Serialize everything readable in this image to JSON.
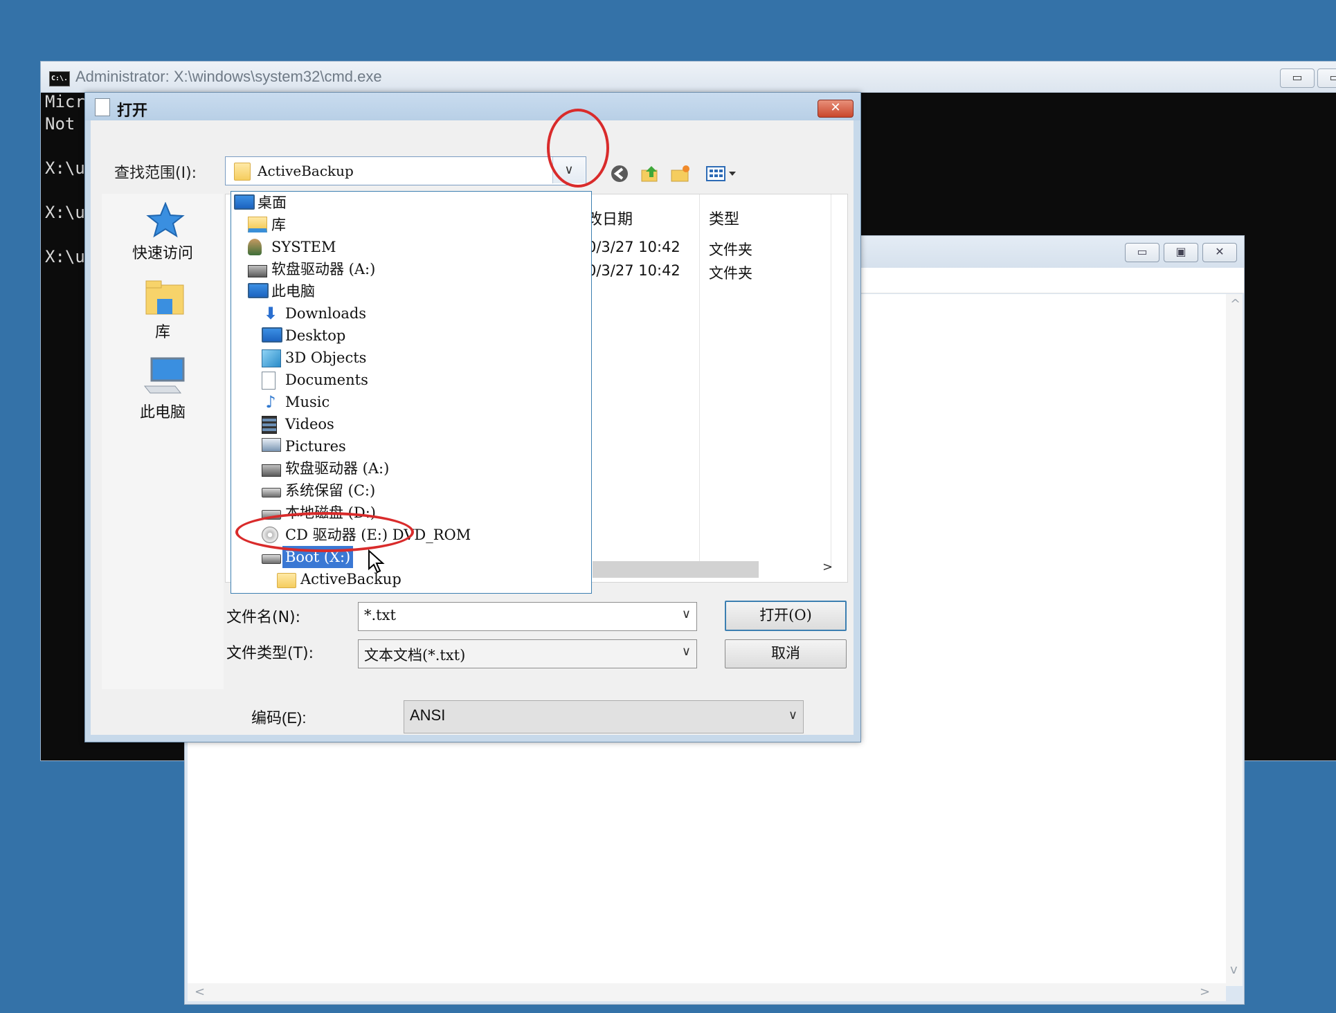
{
  "cmd": {
    "title": "Administrator: X:\\windows\\system32\\cmd.exe",
    "icon_text": "C:\\.",
    "lines": [
      "Micr",
      "Not",
      "X:\\u",
      "X:\\u",
      "X:\\u"
    ],
    "minimize_glyph": "▭",
    "restore_glyph": "▭"
  },
  "notepad": {
    "minimize_glyph": "▭",
    "maximize_glyph": "▣",
    "close_glyph": "✕",
    "scroll_up": "^",
    "scroll_down": "v",
    "scroll_left": "<",
    "scroll_right": ">"
  },
  "dialog": {
    "title": "打开",
    "close_glyph": "✕",
    "lookin_label": "查找范围(I):",
    "lookin_value": "ActiveBackup",
    "dropdown_glyph": "∨",
    "toolbar": {
      "back_icon": "back-icon",
      "up_icon": "up-folder-icon",
      "new_folder_icon": "new-folder-icon",
      "view_menu_icon": "view-menu-icon"
    },
    "places": [
      {
        "label": "快速访问",
        "icon": "star-icon"
      },
      {
        "label": "库",
        "icon": "library-icon"
      },
      {
        "label": "此电脑",
        "icon": "computer-icon"
      }
    ],
    "file_list": {
      "columns": [
        "改日期",
        "类型"
      ],
      "rows": [
        {
          "date": "0/3/27 10:42",
          "type": "文件夹"
        },
        {
          "date": "0/3/27 10:42",
          "type": "文件夹"
        }
      ],
      "scroll_right": ">"
    },
    "tree": [
      {
        "label": "桌面",
        "icon": "desktop-icon",
        "level": 0
      },
      {
        "label": "库",
        "icon": "library-icon",
        "level": 1
      },
      {
        "label": "SYSTEM",
        "icon": "user-icon",
        "level": 1
      },
      {
        "label": "软盘驱动器 (A:)",
        "icon": "floppy-icon",
        "level": 1
      },
      {
        "label": "此电脑",
        "icon": "computer-icon",
        "level": 1
      },
      {
        "label": "Downloads",
        "icon": "downloads-icon",
        "level": 2
      },
      {
        "label": "Desktop",
        "icon": "desktop-icon",
        "level": 2
      },
      {
        "label": "3D Objects",
        "icon": "cube-icon",
        "level": 2
      },
      {
        "label": "Documents",
        "icon": "documents-icon",
        "level": 2
      },
      {
        "label": "Music",
        "icon": "music-icon",
        "level": 2
      },
      {
        "label": "Videos",
        "icon": "videos-icon",
        "level": 2
      },
      {
        "label": "Pictures",
        "icon": "pictures-icon",
        "level": 2
      },
      {
        "label": "软盘驱动器 (A:)",
        "icon": "floppy-icon",
        "level": 2
      },
      {
        "label": "系统保留 (C:)",
        "icon": "drive-icon",
        "level": 2
      },
      {
        "label": "本地磁盘 (D:)",
        "icon": "drive-icon",
        "level": 2
      },
      {
        "label": "CD 驱动器 (E:) DVD_ROM",
        "icon": "cd-icon",
        "level": 2
      },
      {
        "label": "Boot (X:)",
        "icon": "drive-icon",
        "level": 2,
        "selected": true
      },
      {
        "label": "ActiveBackup",
        "icon": "folder-icon",
        "level": 3
      }
    ],
    "filename_label": "文件名(N):",
    "filename_value": "*.txt",
    "filetype_label": "文件类型(T):",
    "filetype_value": "文本文档(*.txt)",
    "open_button": "打开(O)",
    "cancel_button": "取消",
    "encoding_label": "编码(E):",
    "encoding_value": "ANSI",
    "combo_arrow": "∨"
  },
  "colors": {
    "desktop": "#3472a8",
    "selection": "#3a78d4",
    "annotation": "#d92b2b"
  }
}
